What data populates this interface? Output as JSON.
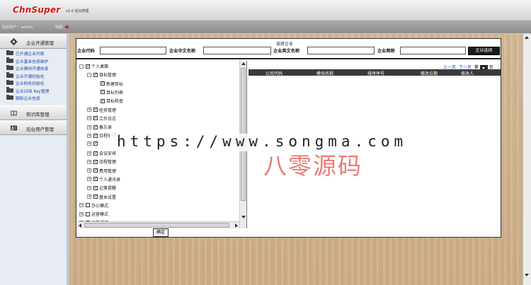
{
  "header": {
    "logo": "ChnSuper",
    "version": "v1.0 后台管理"
  },
  "statusbar": {
    "current_user": "当前用户：admin",
    "collapse_label": "收起"
  },
  "sidebar": {
    "sections": [
      {
        "label": "企业开通管理",
        "icon": "gear-icon"
      },
      {
        "label": "知识库管理",
        "icon": "book-icon"
      },
      {
        "label": "后台用户管理",
        "icon": "user-card-icon"
      }
    ],
    "items": [
      {
        "label": "已开通企业列表"
      },
      {
        "label": "企业基本信息维护"
      },
      {
        "label": "企业模块开通信息"
      },
      {
        "label": "企业开通初始化"
      },
      {
        "label": "企业财务初始化"
      },
      {
        "label": "企业USB Key管理"
      },
      {
        "label": "删除企业信息"
      }
    ]
  },
  "form": {
    "title": "选择企业",
    "code_label": "企业代码",
    "cn_name_label": "企业中文名称",
    "en_name_label": "企业英文名称",
    "short_name_label": "企业简称",
    "code_value": "",
    "cn_name_value": "",
    "en_name_value": "",
    "short_name_value": "",
    "select_button": "企业选择"
  },
  "tree": {
    "items": [
      {
        "label": "个人桌面",
        "expander": "-",
        "checked": true,
        "level": 0
      },
      {
        "label": "目标管理",
        "expander": "-",
        "checked": true,
        "level": 1
      },
      {
        "label": "新建目标",
        "expander": "",
        "checked": true,
        "level": 2
      },
      {
        "label": "目标列表",
        "expander": "",
        "checked": true,
        "level": 2
      },
      {
        "label": "目标检查",
        "expander": "",
        "checked": true,
        "level": 2
      },
      {
        "label": "任务管理",
        "expander": "+",
        "checked": true,
        "level": 1
      },
      {
        "label": "工作日志",
        "expander": "+",
        "checked": true,
        "level": 1
      },
      {
        "label": "备忘录",
        "expander": "+",
        "checked": true,
        "level": 1
      },
      {
        "label": "日程安排",
        "expander": "+",
        "checked": true,
        "level": 1
      },
      {
        "label": "",
        "expander": "+",
        "checked": true,
        "level": 1
      },
      {
        "label": "会议安排",
        "expander": "+",
        "checked": true,
        "level": 1
      },
      {
        "label": "流程管理",
        "expander": "+",
        "checked": true,
        "level": 1
      },
      {
        "label": "费用管理",
        "expander": "+",
        "checked": true,
        "level": 1
      },
      {
        "label": "个人通讯录",
        "expander": "+",
        "checked": true,
        "level": 1
      },
      {
        "label": "记事提醒",
        "expander": "+",
        "checked": true,
        "level": 1
      },
      {
        "label": "基本设置",
        "expander": "+",
        "checked": true,
        "level": 1
      },
      {
        "label": "办公模式",
        "expander": "+",
        "checked": false,
        "level": 0
      },
      {
        "label": "运营模式",
        "expander": "+",
        "checked": false,
        "level": 0
      },
      {
        "label": "决策模式",
        "expander": "+",
        "checked": false,
        "level": 0
      }
    ],
    "confirm_button": "确定"
  },
  "list": {
    "prev_page": "上一页",
    "next_page": "下一页",
    "page_prefix": "第",
    "page_suffix": "页",
    "columns": [
      "公司代码",
      "模块名称",
      "排序序号",
      "修改日期",
      "修改人"
    ]
  },
  "watermark": {
    "url": "https://www.songma.com",
    "cn": "八零源码"
  }
}
